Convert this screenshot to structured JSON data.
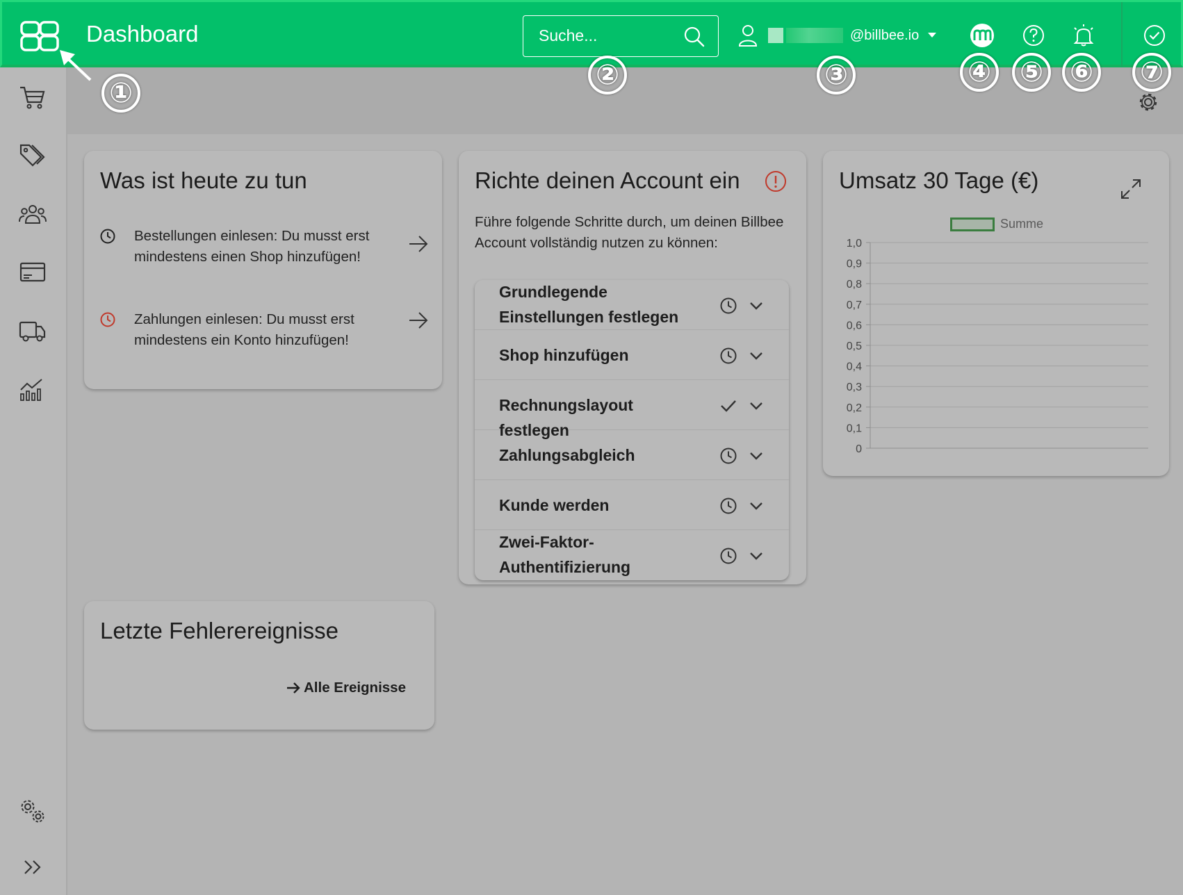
{
  "header": {
    "title": "Dashboard",
    "search_placeholder": "Suche...",
    "user_email_suffix": "@billbee.io"
  },
  "annotations": [
    "①",
    "②",
    "③",
    "④",
    "⑤",
    "⑥",
    "⑦"
  ],
  "sidebar": {
    "items": [
      "cart-icon",
      "tags-icon",
      "customers-icon",
      "payments-icon",
      "shipping-icon",
      "statistics-icon"
    ],
    "bottom": [
      "settings-icon",
      "expand-icon"
    ]
  },
  "todo": {
    "title": "Was ist heute zu tun",
    "items": [
      {
        "text": "Bestellungen einlesen: Du musst erst mindestens einen Shop hinzufügen!",
        "status": "pending"
      },
      {
        "text": "Zahlungen einlesen: Du musst erst mindestens ein Konto hinzufügen!",
        "status": "warning"
      }
    ]
  },
  "setup": {
    "title": "Richte deinen Account ein",
    "intro": "Führe folgende Schritte durch, um deinen Billbee Account vollständig nutzen zu können:",
    "steps": [
      {
        "label": "Grundlegende Einstellungen festlegen",
        "status": "pending"
      },
      {
        "label": "Shop hinzufügen",
        "status": "pending"
      },
      {
        "label": "Rechnungslayout festlegen",
        "status": "done"
      },
      {
        "label": "Zahlungsabgleich",
        "status": "pending"
      },
      {
        "label": "Kunde werden",
        "status": "pending"
      },
      {
        "label": "Zwei-Faktor-Authentifizierung",
        "status": "pending"
      }
    ]
  },
  "revenue": {
    "title": "Umsatz 30 Tage (€)"
  },
  "chart_data": {
    "type": "line",
    "title": "Umsatz 30 Tage (€)",
    "series": [
      {
        "name": "Summe",
        "values": []
      }
    ],
    "ylim": [
      0,
      1
    ],
    "yticks": [
      "1,0",
      "0,9",
      "0,8",
      "0,7",
      "0,6",
      "0,5",
      "0,4",
      "0,3",
      "0,2",
      "0,1",
      "0"
    ],
    "legend": "top",
    "grid": true
  },
  "errors": {
    "title": "Letzte Fehlerereignisse",
    "all_link": "Alle Ereignisse"
  },
  "colors": {
    "brand": "#03c06a",
    "warning": "#c0392b",
    "background": "#b4b4b4"
  }
}
